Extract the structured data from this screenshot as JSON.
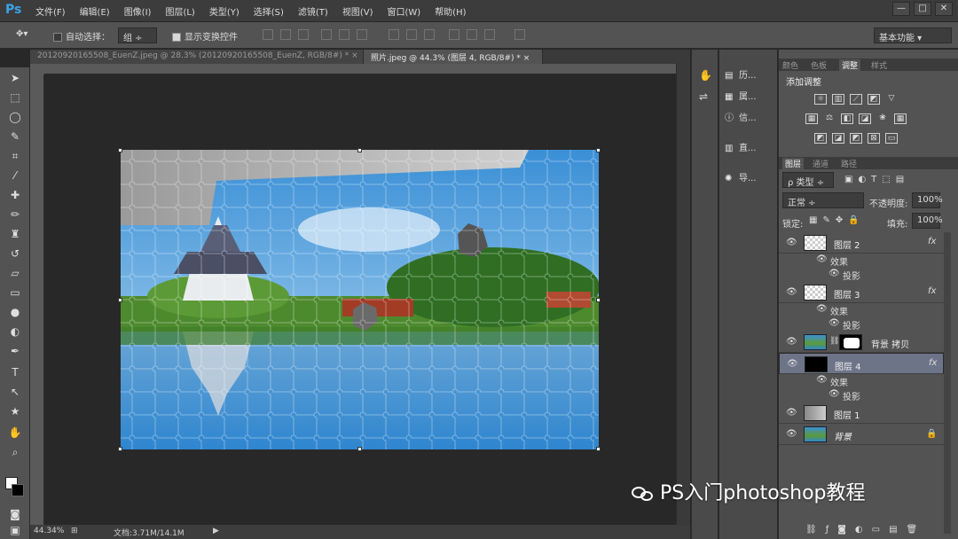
{
  "app": {
    "logo": "Ps",
    "menu": [
      "文件(F)",
      "编辑(E)",
      "图像(I)",
      "图层(L)",
      "类型(Y)",
      "选择(S)",
      "滤镜(T)",
      "视图(V)",
      "窗口(W)",
      "帮助(H)"
    ],
    "window_controls": [
      "—",
      "□",
      "✕"
    ],
    "workspace": "基本功能 ▾"
  },
  "options": {
    "auto_select_label": "自动选择：",
    "auto_select_value": "组 ÷",
    "show_transform_label": "显示变换控件"
  },
  "tabs": [
    {
      "label": "20120920165508_EuenZ.jpeg @ 28.3% (20120920165508_EuenZ, RGB/8#) *  ×"
    },
    {
      "label": "照片.jpeg @ 44.3% (图层 4, RGB/8#) *  ×"
    }
  ],
  "status": {
    "zoom": "44.34%",
    "doc": "文档:3.71M/14.1M"
  },
  "dock2": [
    "历...",
    "属...",
    "信...",
    "直...",
    "导..."
  ],
  "panels": {
    "top_tabs": [
      "颜色",
      "色板",
      "调整",
      "样式"
    ],
    "adj_title": "添加调整",
    "layers_tabs": [
      "图层",
      "通道",
      "路径"
    ],
    "kind_select": "ρ 类型 ÷",
    "blend_mode": "正常 ÷",
    "opacity_label": "不透明度:",
    "opacity_value": "100%",
    "lock_label": "锁定:",
    "fill_label": "填充:",
    "fill_value": "100%"
  },
  "layers": [
    {
      "name": "图层 2",
      "fx": "fx"
    },
    {
      "effect": "效果",
      "sub": "投影"
    },
    {
      "name": "图层 3",
      "fx": "fx"
    },
    {
      "effect": "效果",
      "sub": "投影"
    },
    {
      "name": "背景 拷贝"
    },
    {
      "name": "图层 4",
      "fx": "fx"
    },
    {
      "effect": "效果",
      "sub": "投影"
    },
    {
      "name": "图层 1"
    },
    {
      "name": "背景"
    }
  ],
  "watermark": "PS入门photoshop教程",
  "colors": {
    "accent": "#3ba3e8",
    "selected_layer": "#6e7488"
  }
}
